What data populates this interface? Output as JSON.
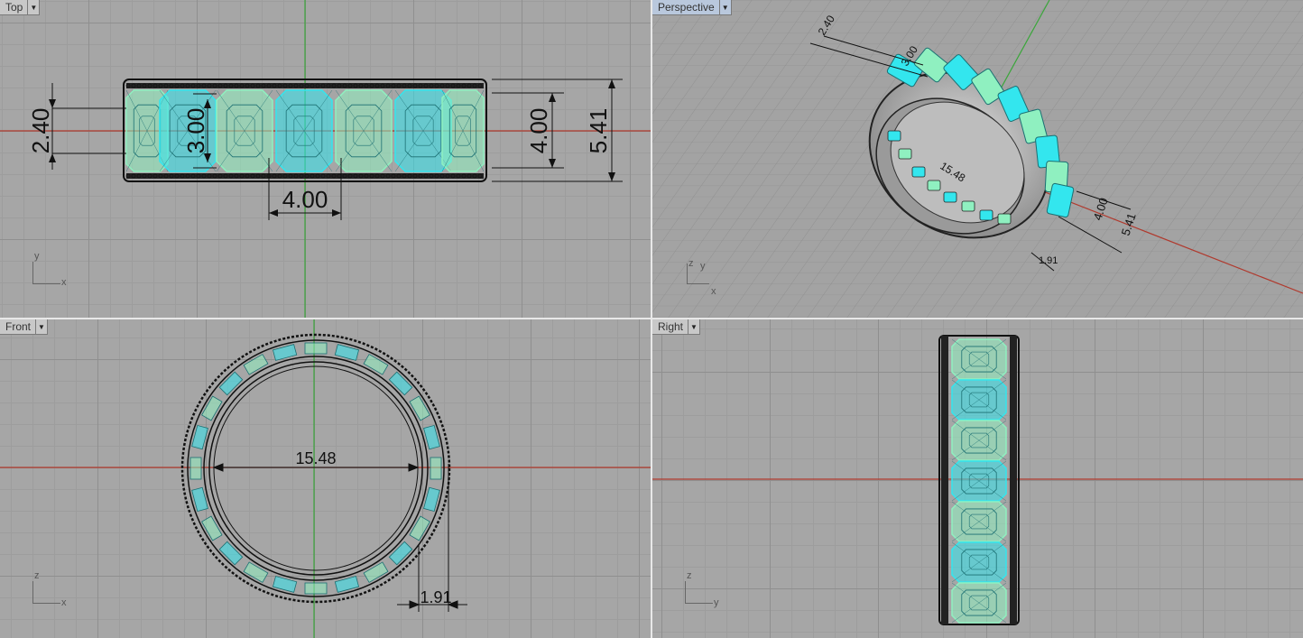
{
  "viewports": {
    "top": {
      "label": "Top",
      "axes": {
        "v": "y",
        "h": "x"
      }
    },
    "persp": {
      "label": "Perspective",
      "axes": {
        "v": "z",
        "h": "x",
        "d": "y"
      }
    },
    "front": {
      "label": "Front",
      "axes": {
        "v": "z",
        "h": "x"
      }
    },
    "right": {
      "label": "Right",
      "axes": {
        "v": "z",
        "h": "y"
      }
    }
  },
  "dimensions": {
    "stone_width": "2.40",
    "stone_length_inner": "3.00",
    "stone_length": "4.00",
    "band_width": "5.41",
    "inner_diameter": "15.48",
    "band_thickness": "1.91"
  },
  "colors": {
    "stone_cyan": "#33e6ee",
    "stone_mint": "#8ff0c0",
    "axis_green": "#3aa63a",
    "axis_red": "#c0392b",
    "metal": "#b8b8b8"
  }
}
